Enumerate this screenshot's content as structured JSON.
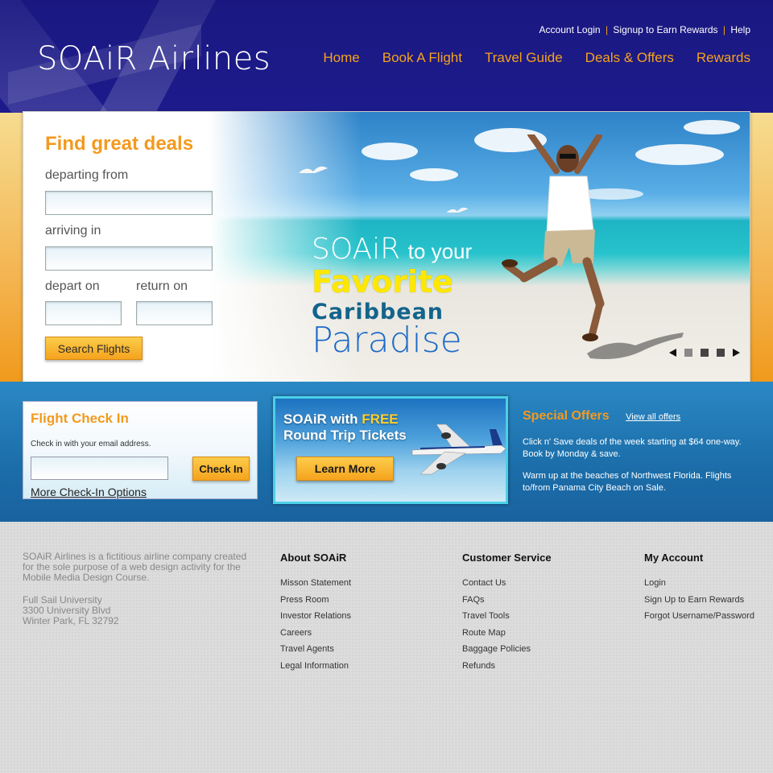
{
  "header": {
    "logo": "SOAiR Airlines",
    "top_links": [
      "Account Login",
      "Signup to Earn Rewards",
      "Help"
    ],
    "separator": "|",
    "nav": [
      "Home",
      "Book A Flight",
      "Travel Guide",
      "Deals & Offers",
      "Rewards"
    ]
  },
  "hero": {
    "title": "Find great deals",
    "departing_label": "departing from",
    "arriving_label": "arriving in",
    "depart_on_label": "depart on",
    "return_on_label": "return on",
    "search_button": "Search Flights",
    "promo": {
      "line1_brand": "SOAiR",
      "line1_rest": "to your",
      "line2": "Favorite",
      "line3": "Caribbean",
      "line4": "Paradise"
    },
    "slider": {
      "total": 4,
      "active": 1
    }
  },
  "checkin": {
    "title": "Flight Check In",
    "description": "Check in with your email address.",
    "button": "Check In",
    "more_link": "More Check-In Options"
  },
  "free_promo": {
    "line1_prefix": "SOAiR with",
    "line1_highlight": "FREE",
    "line2": "Round Trip Tickets",
    "button": "Learn More"
  },
  "offers": {
    "title": "Special Offers",
    "view_all": "View all offers",
    "items": [
      "Click n' Save deals of the week starting at $64 one-way. Book by Monday & save.",
      "Warm up at the beaches of Northwest Florida. Flights to/from Panama City Beach on Sale."
    ]
  },
  "footer": {
    "about": "SOAiR Airlines is a fictitious airline company created for the sole purpose of a web design activity for the Mobile Media Design Course.",
    "address": [
      "Full Sail University",
      "3300 University Blvd",
      "Winter Park, FL 32792"
    ],
    "columns": [
      {
        "title": "About SOAiR",
        "items": [
          "Misson Statement",
          "Press Room",
          "Investor Relations",
          "Careers",
          "Travel Agents",
          "Legal Information"
        ]
      },
      {
        "title": "Customer Service",
        "items": [
          "Contact Us",
          "FAQs",
          "Travel Tools",
          "Route Map",
          "Baggage Policies",
          "Refunds"
        ]
      },
      {
        "title": "My Account",
        "items": [
          "Login",
          "Sign Up to Earn Rewards",
          "Forgot Username/Password"
        ]
      }
    ]
  },
  "colors": {
    "header_bg": "#1a1880",
    "accent_orange": "#f39a1e",
    "mid_band": "#1b6ea9",
    "footer_bg": "#dcdcdc"
  },
  "icons": [
    "chevron-left-icon",
    "chevron-right-icon"
  ]
}
